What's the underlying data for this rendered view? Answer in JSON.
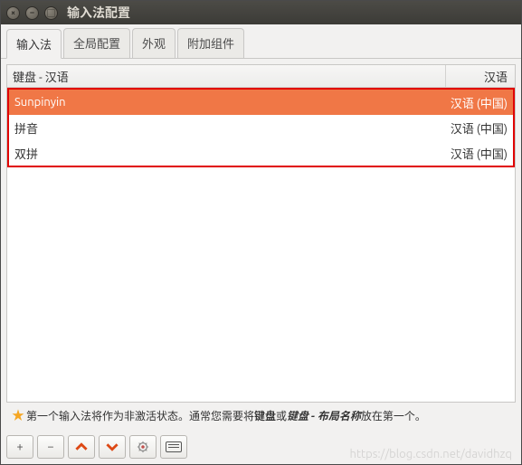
{
  "window": {
    "title": "输入法配置"
  },
  "tabs": [
    {
      "label": "输入法",
      "active": true
    },
    {
      "label": "全局配置",
      "active": false
    },
    {
      "label": "外观",
      "active": false
    },
    {
      "label": "附加组件",
      "active": false
    }
  ],
  "list": {
    "headers": {
      "left": "键盘 - 汉语",
      "right": "汉语"
    },
    "rows": [
      {
        "name": "Sunpinyin",
        "lang": "汉语 (中国)",
        "selected": true
      },
      {
        "name": "拼音",
        "lang": "汉语 (中国)",
        "selected": false
      },
      {
        "name": "双拼",
        "lang": "汉语 (中国)",
        "selected": false
      }
    ]
  },
  "hint": {
    "pre": "第一个输入法将作为非激活状态。通常您需要将",
    "b1": "键盘",
    "mid": "或",
    "b2": "键盘 - 布局名称",
    "post": "放在第一个。"
  },
  "toolbar": {
    "add": "+",
    "remove": "−"
  },
  "watermark": "https://blog.csdn.net/davidhzq"
}
